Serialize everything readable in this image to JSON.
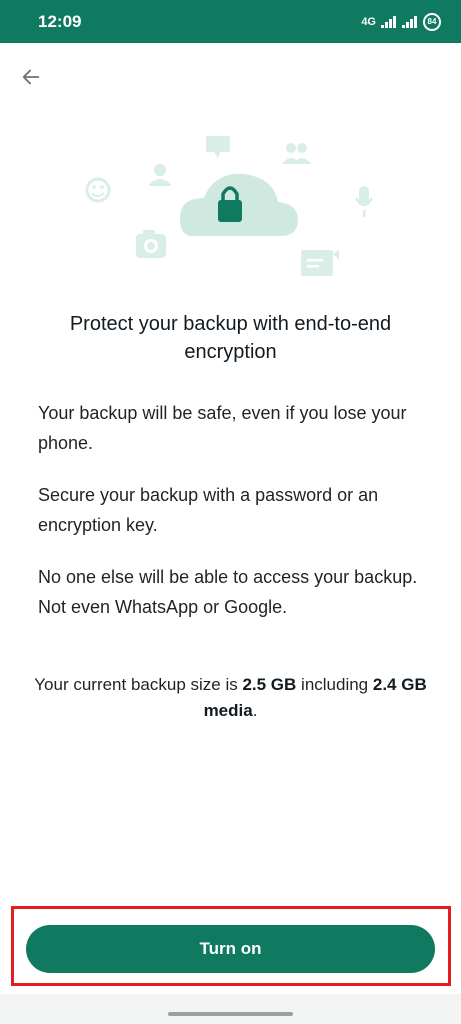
{
  "status_bar": {
    "time": "12:09",
    "network": "4G",
    "battery": "84"
  },
  "header": {
    "back_icon": "arrow-left-icon"
  },
  "illustration": {
    "icons": [
      "cloud-lock-icon",
      "smiley-icon",
      "person-icon",
      "camera-icon",
      "chat-icon",
      "group-icon",
      "microphone-icon",
      "message-icon"
    ],
    "accent": "#cfe9e1",
    "accent_dark": "#0f7a5f"
  },
  "main": {
    "title": "Protect your backup with end-to-end encryption",
    "paragraphs": [
      "Your backup will be safe, even if you lose your phone.",
      "Secure your backup with a password or an encryption key.",
      "No one else will be able to access your backup. Not even WhatsApp or Google."
    ],
    "size_info": {
      "prefix": "Your current backup size is ",
      "size": "2.5 GB",
      "middle": " including ",
      "media": "2.4 GB media",
      "suffix": "."
    }
  },
  "footer": {
    "turn_on_label": "Turn on"
  },
  "colors": {
    "brand": "#0f7a5f",
    "highlight": "#e02020"
  }
}
